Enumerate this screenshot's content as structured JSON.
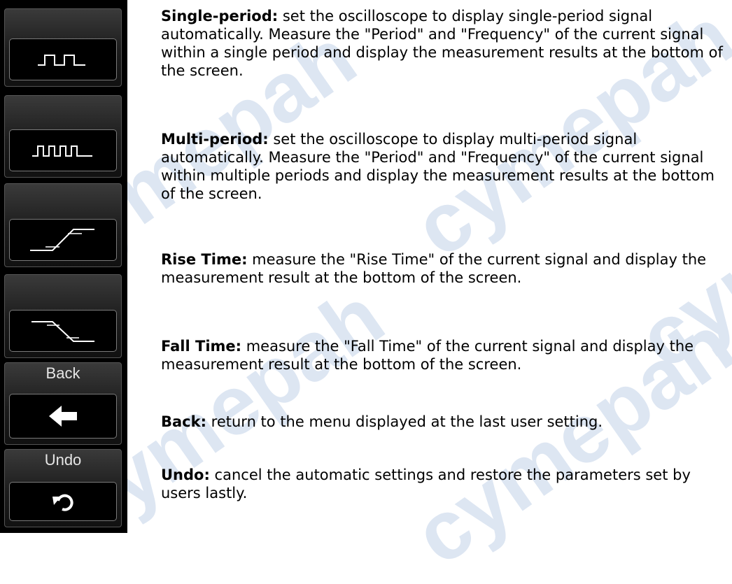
{
  "menu": {
    "items": [
      {
        "icon": "single-period-icon"
      },
      {
        "icon": "multi-period-icon"
      },
      {
        "icon": "rise-time-icon"
      },
      {
        "icon": "fall-time-icon"
      },
      {
        "label": "Back",
        "icon": "back-arrow-icon"
      },
      {
        "label": "Undo",
        "icon": "undo-icon"
      }
    ]
  },
  "descriptions": [
    {
      "term": "Single-period:",
      "text": " set the oscilloscope to display single-period signal automatically. Measure the \"Period\" and \"Frequency\" of the current signal within a single period and display the measurement results at the bottom of the screen."
    },
    {
      "term": "Multi-period:",
      "text": " set the oscilloscope to display multi-period signal automatically. Measure the \"Period\" and \"Frequency\" of the current signal within multiple periods and display the measurement results at the bottom of the screen."
    },
    {
      "term": "Rise Time:",
      "text": " measure the \"Rise Time\" of the current signal and display the measurement result at the bottom of the screen."
    },
    {
      "term": "Fall Time:",
      "text": " measure the \"Fall Time\" of the current signal and display the measurement result at the bottom of the screen."
    },
    {
      "term": "Back:",
      "text": " return to the menu displayed at the last user setting."
    },
    {
      "term": "Undo:",
      "text": " cancel the automatic settings and restore the parameters set by users lastly."
    }
  ],
  "watermark": "cymepah"
}
